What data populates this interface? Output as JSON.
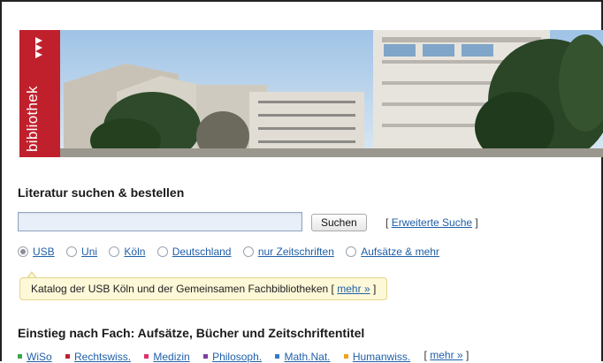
{
  "logo": {
    "text": "bibliothek"
  },
  "search": {
    "heading": "Literatur suchen & bestellen",
    "input_value": "",
    "button_label": "Suchen",
    "advanced_open": "[",
    "advanced_label": "Erweiterte Suche",
    "advanced_close": "]"
  },
  "scopes": [
    {
      "label": "USB",
      "selected": true
    },
    {
      "label": "Uni",
      "selected": false
    },
    {
      "label": "Köln",
      "selected": false
    },
    {
      "label": "Deutschland",
      "selected": false
    },
    {
      "label": "nur Zeitschriften",
      "selected": false
    },
    {
      "label": "Aufsätze & mehr",
      "selected": false
    }
  ],
  "hint": {
    "text": "Katalog der USB Köln und der Gemeinsamen Fachbibliotheken",
    "open": "[",
    "more_label": "mehr »",
    "close": "]"
  },
  "subjects": {
    "heading": "Einstieg nach Fach: Aufsätze, Bücher und Zeitschriftentitel",
    "items": [
      {
        "label": "WiSo",
        "color": "#3aa84a"
      },
      {
        "label": "Rechtswiss.",
        "color": "#c0202c"
      },
      {
        "label": "Medizin",
        "color": "#e0306a"
      },
      {
        "label": "Philosoph.",
        "color": "#7b3fa0"
      },
      {
        "label": "Math.Nat.",
        "color": "#2f7bd0"
      },
      {
        "label": "Humanwiss.",
        "color": "#f0a020"
      }
    ],
    "more_open": "[",
    "more_label": "mehr »",
    "more_close": "]"
  },
  "colors": {
    "brand_red": "#c0202c",
    "link_blue": "#1f5fa8"
  }
}
